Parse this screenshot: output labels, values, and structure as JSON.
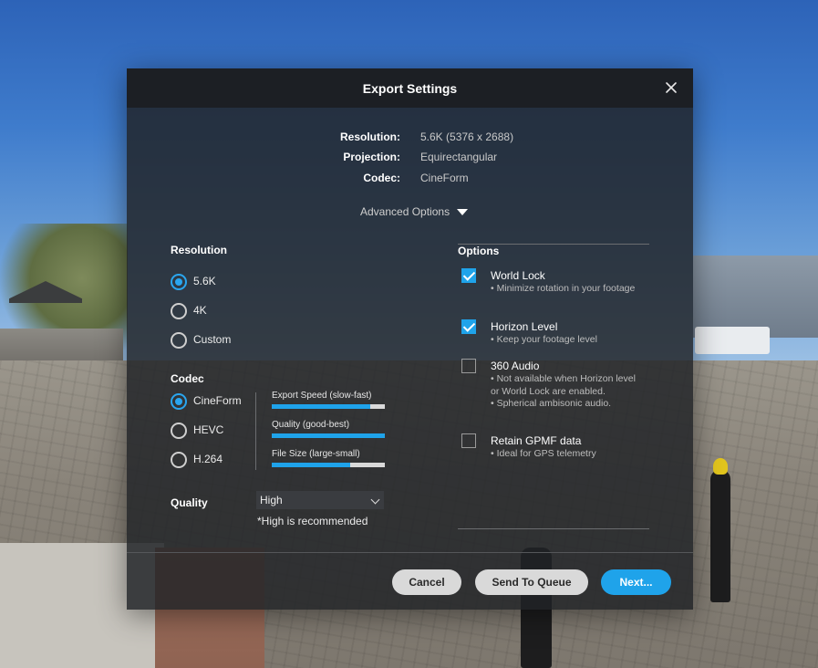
{
  "dialog": {
    "title": "Export Settings",
    "summary": [
      {
        "label": "Resolution:",
        "value": "5.6K (5376 x 2688)"
      },
      {
        "label": "Projection:",
        "value": "Equirectangular"
      },
      {
        "label": "Codec:",
        "value": "CineForm"
      }
    ],
    "advanced_options_label": "Advanced Options",
    "resolution": {
      "heading": "Resolution",
      "options": [
        {
          "label": "5.6K",
          "selected": true
        },
        {
          "label": "4K",
          "selected": false
        },
        {
          "label": "Custom",
          "selected": false
        }
      ]
    },
    "codec": {
      "heading": "Codec",
      "options": [
        {
          "label": "CineForm",
          "selected": true
        },
        {
          "label": "HEVC",
          "selected": false
        },
        {
          "label": "H.264",
          "selected": false
        }
      ],
      "meters": [
        {
          "label": "Export Speed (slow-fast)",
          "level": 0.87
        },
        {
          "label": "Quality (good-best)",
          "level": 1.0
        },
        {
          "label": "File Size (large-small)",
          "level": 0.69
        }
      ]
    },
    "quality": {
      "label": "Quality",
      "selected_value": "High",
      "hint": "*High is recommended"
    },
    "options": {
      "heading": "Options",
      "items": [
        {
          "title": "World Lock",
          "checked": true,
          "description": "• Minimize rotation in your footage"
        },
        {
          "title": "Horizon Level",
          "checked": true,
          "description": "• Keep your footage level"
        },
        {
          "title": "360 Audio",
          "checked": false,
          "description": "• Not available when Horizon level or World Lock are enabled.\n• Spherical ambisonic audio."
        },
        {
          "title": "Retain GPMF data",
          "checked": false,
          "description": "• Ideal for GPS telemetry"
        }
      ]
    },
    "buttons": {
      "cancel": "Cancel",
      "send_to_queue": "Send To Queue",
      "next": "Next..."
    }
  },
  "colors": {
    "accent": "#1fa3ea",
    "dialog_bg": "#202226",
    "button_grey": "#d9d9d9"
  }
}
